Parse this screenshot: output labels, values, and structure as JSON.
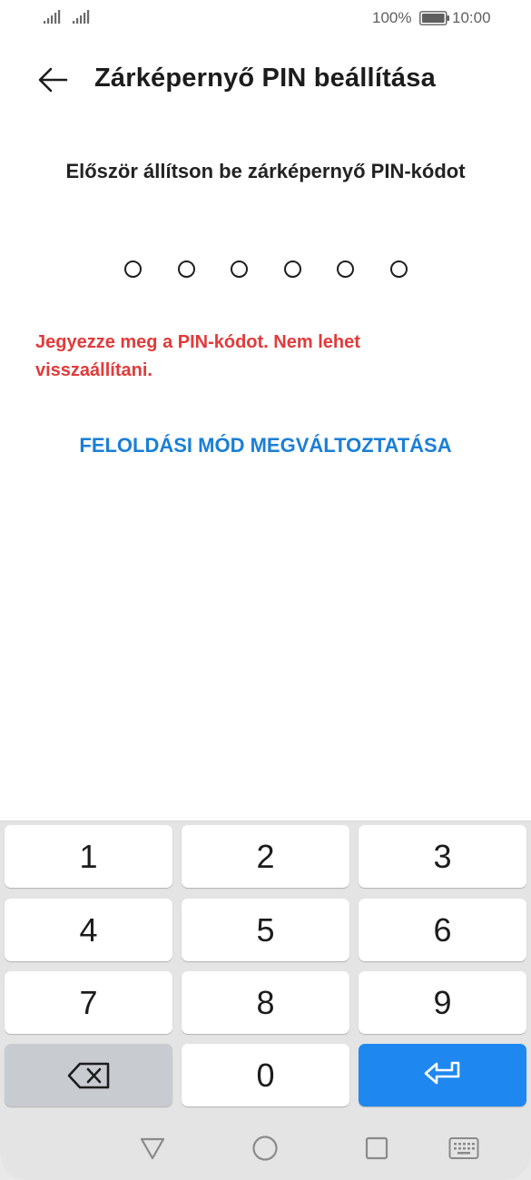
{
  "status_bar": {
    "battery_percent": "100%",
    "time": "10:00"
  },
  "header": {
    "title": "Zárképernyő PIN beállítása"
  },
  "main": {
    "instruction": "Először állítson be zárképernyő PIN-kódot",
    "pin_length": 6,
    "pin_filled": 0,
    "warning": "Jegyezze meg a PIN-kódot. Nem lehet visszaállítani.",
    "change_mode_label": "FELOLDÁSI MÓD MEGVÁLTOZTATÁSA"
  },
  "keypad": {
    "keys": [
      "1",
      "2",
      "3",
      "4",
      "5",
      "6",
      "7",
      "8",
      "9",
      "0"
    ]
  },
  "colors": {
    "warning": "#e23a3a",
    "link": "#1a7fd6",
    "enter_key": "#1e88f0"
  }
}
